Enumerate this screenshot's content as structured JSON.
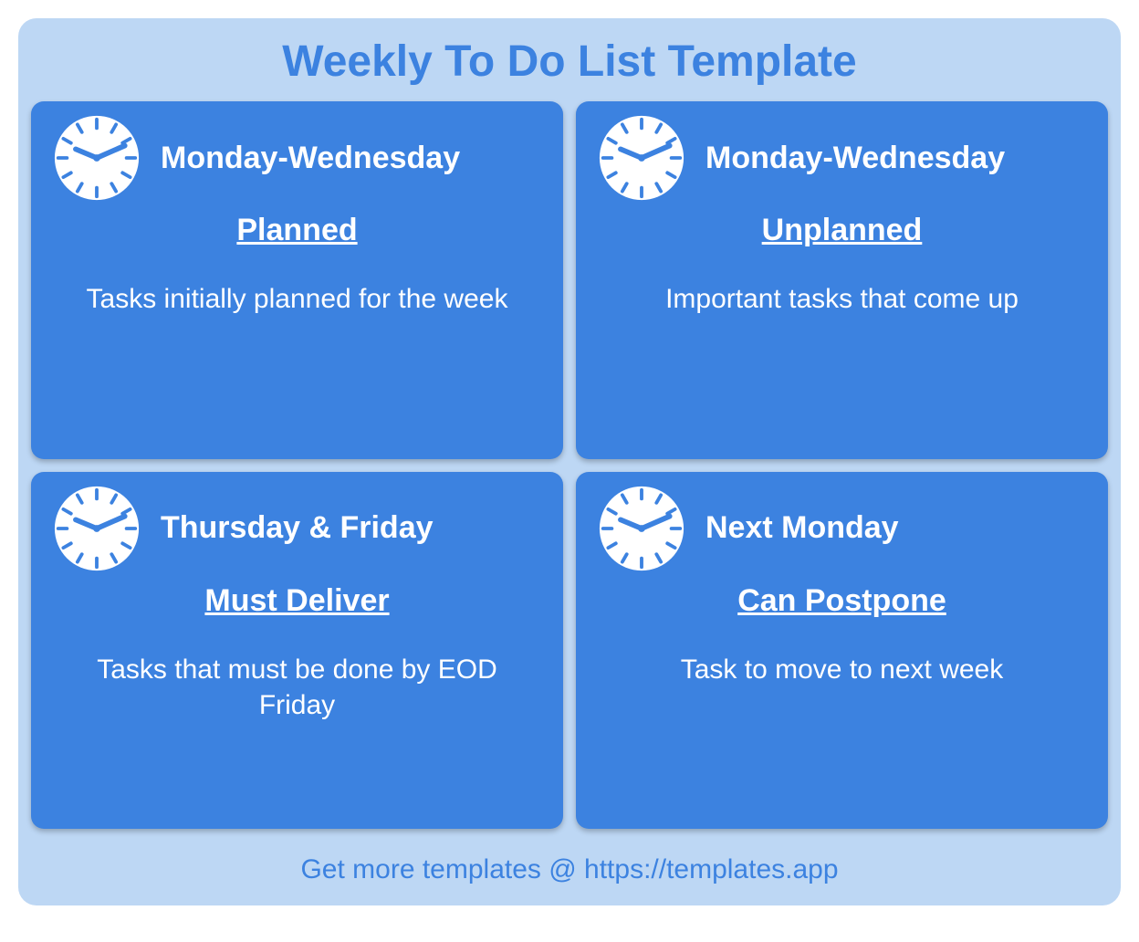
{
  "title": "Weekly To Do List Template",
  "cards": [
    {
      "days": "Monday-Wednesday",
      "category": "Planned",
      "desc": "Tasks initially planned for the week"
    },
    {
      "days": "Monday-Wednesday",
      "category": "Unplanned",
      "desc": "Important tasks that come up"
    },
    {
      "days": "Thursday & Friday",
      "category": "Must Deliver",
      "desc": "Tasks that must be done by EOD Friday"
    },
    {
      "days": "Next Monday",
      "category": "Can Postpone",
      "desc": "Task to move to next week"
    }
  ],
  "footer": "Get more templates @ https://templates.app"
}
